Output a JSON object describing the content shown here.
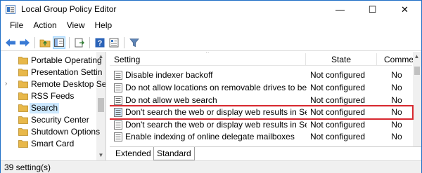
{
  "window": {
    "title": "Local Group Policy Editor",
    "minimize_glyph": "—",
    "maximize_glyph": "☐",
    "close_glyph": "✕"
  },
  "menu": [
    "File",
    "Action",
    "View",
    "Help"
  ],
  "toolbar": {
    "buttons": [
      "back-icon",
      "forward-icon",
      "up-folder-icon",
      "show-hide-tree-icon",
      "export-list-icon",
      "help-icon",
      "properties-icon",
      "filter-icon"
    ]
  },
  "tree": {
    "items": [
      {
        "label": "Portable Operating",
        "expandable": false
      },
      {
        "label": "Presentation Settin",
        "expandable": false
      },
      {
        "label": "Remote Desktop Se",
        "expandable": true
      },
      {
        "label": "RSS Feeds",
        "expandable": false
      },
      {
        "label": "Search",
        "expandable": false,
        "selected": true
      },
      {
        "label": "Security Center",
        "expandable": false
      },
      {
        "label": "Shutdown Options",
        "expandable": false
      },
      {
        "label": "Smart Card",
        "expandable": false
      }
    ]
  },
  "list": {
    "columns": {
      "setting": "Setting",
      "state": "State",
      "comment": "Comment"
    },
    "rows": [
      {
        "setting": "Disable indexer backoff",
        "state": "Not configured",
        "comment": "No"
      },
      {
        "setting": "Do not allow locations on removable drives to be a...",
        "state": "Not configured",
        "comment": "No"
      },
      {
        "setting": "Do not allow web search",
        "state": "Not configured",
        "comment": "No"
      },
      {
        "setting": "Don't search the web or display web results in Search",
        "state": "Not configured",
        "comment": "No",
        "highlighted": true
      },
      {
        "setting": "Don't search the web or display web results in Searc...",
        "state": "Not configured",
        "comment": "No"
      },
      {
        "setting": "Enable indexing of online delegate mailboxes",
        "state": "Not configured",
        "comment": "No"
      }
    ]
  },
  "tabs": [
    "Extended",
    "Standard"
  ],
  "active_tab": "Standard",
  "status": "39 setting(s)",
  "colors": {
    "highlight_border": "#d7282f",
    "selection": "#cce8ff",
    "folder": "#e8b84a"
  }
}
